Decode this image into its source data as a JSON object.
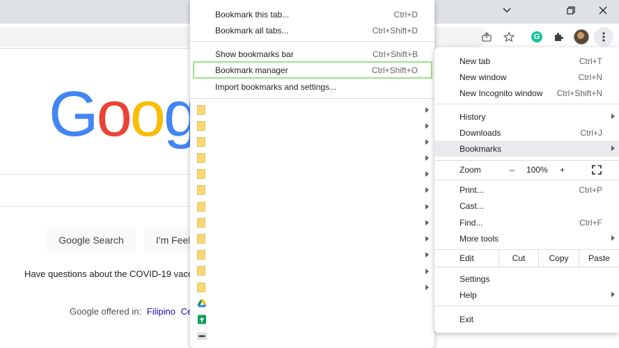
{
  "window": {
    "buttons": [
      "minimize",
      "restore",
      "close"
    ]
  },
  "page": {
    "logo_letters": [
      {
        "ch": "G",
        "color": "#4285f4"
      },
      {
        "ch": "o",
        "color": "#ea4335"
      },
      {
        "ch": "o",
        "color": "#fbbc05"
      },
      {
        "ch": "g",
        "color": "#4285f4"
      }
    ],
    "search_button": "Google Search",
    "lucky_button": "I'm Feel",
    "covid_text": "Have questions about the COVID-19 vacc",
    "offered_prefix": "Google offered in:",
    "offered_lang": "Filipino",
    "offered_lang2": "Ce"
  },
  "bookmarks_menu": {
    "items": [
      {
        "label": "Bookmark this tab...",
        "shortcut": "Ctrl+D"
      },
      {
        "label": "Bookmark all tabs...",
        "shortcut": "Ctrl+Shift+D"
      },
      {
        "label": "Show bookmarks bar",
        "shortcut": "Ctrl+Shift+B"
      },
      {
        "label": "Bookmark manager",
        "shortcut": "Ctrl+Shift+O"
      },
      {
        "label": "Import bookmarks and settings...",
        "shortcut": ""
      }
    ],
    "folder_count": 12,
    "favicons": [
      "google-drive-icon",
      "google-sheets-icon",
      "site-favicon"
    ]
  },
  "chrome_menu": {
    "new_tab": {
      "label": "New tab",
      "shortcut": "Ctrl+T"
    },
    "new_window": {
      "label": "New window",
      "shortcut": "Ctrl+N"
    },
    "new_incognito": {
      "label": "New Incognito window",
      "shortcut": "Ctrl+Shift+N"
    },
    "history": {
      "label": "History"
    },
    "downloads": {
      "label": "Downloads",
      "shortcut": "Ctrl+J"
    },
    "bookmarks": {
      "label": "Bookmarks"
    },
    "zoom": {
      "label": "Zoom",
      "minus": "–",
      "level": "100%",
      "plus": "+"
    },
    "print": {
      "label": "Print...",
      "shortcut": "Ctrl+P"
    },
    "cast": {
      "label": "Cast..."
    },
    "find": {
      "label": "Find...",
      "shortcut": "Ctrl+F"
    },
    "more_tools": {
      "label": "More tools"
    },
    "edit": {
      "label": "Edit",
      "cut": "Cut",
      "copy": "Copy",
      "paste": "Paste"
    },
    "settings": {
      "label": "Settings"
    },
    "help": {
      "label": "Help"
    },
    "exit": {
      "label": "Exit"
    }
  },
  "colors": {
    "titlebar": "#dee1e6",
    "highlight_border": "#9ee089",
    "folder": "#fad776",
    "active_row": "#e8eaed"
  }
}
